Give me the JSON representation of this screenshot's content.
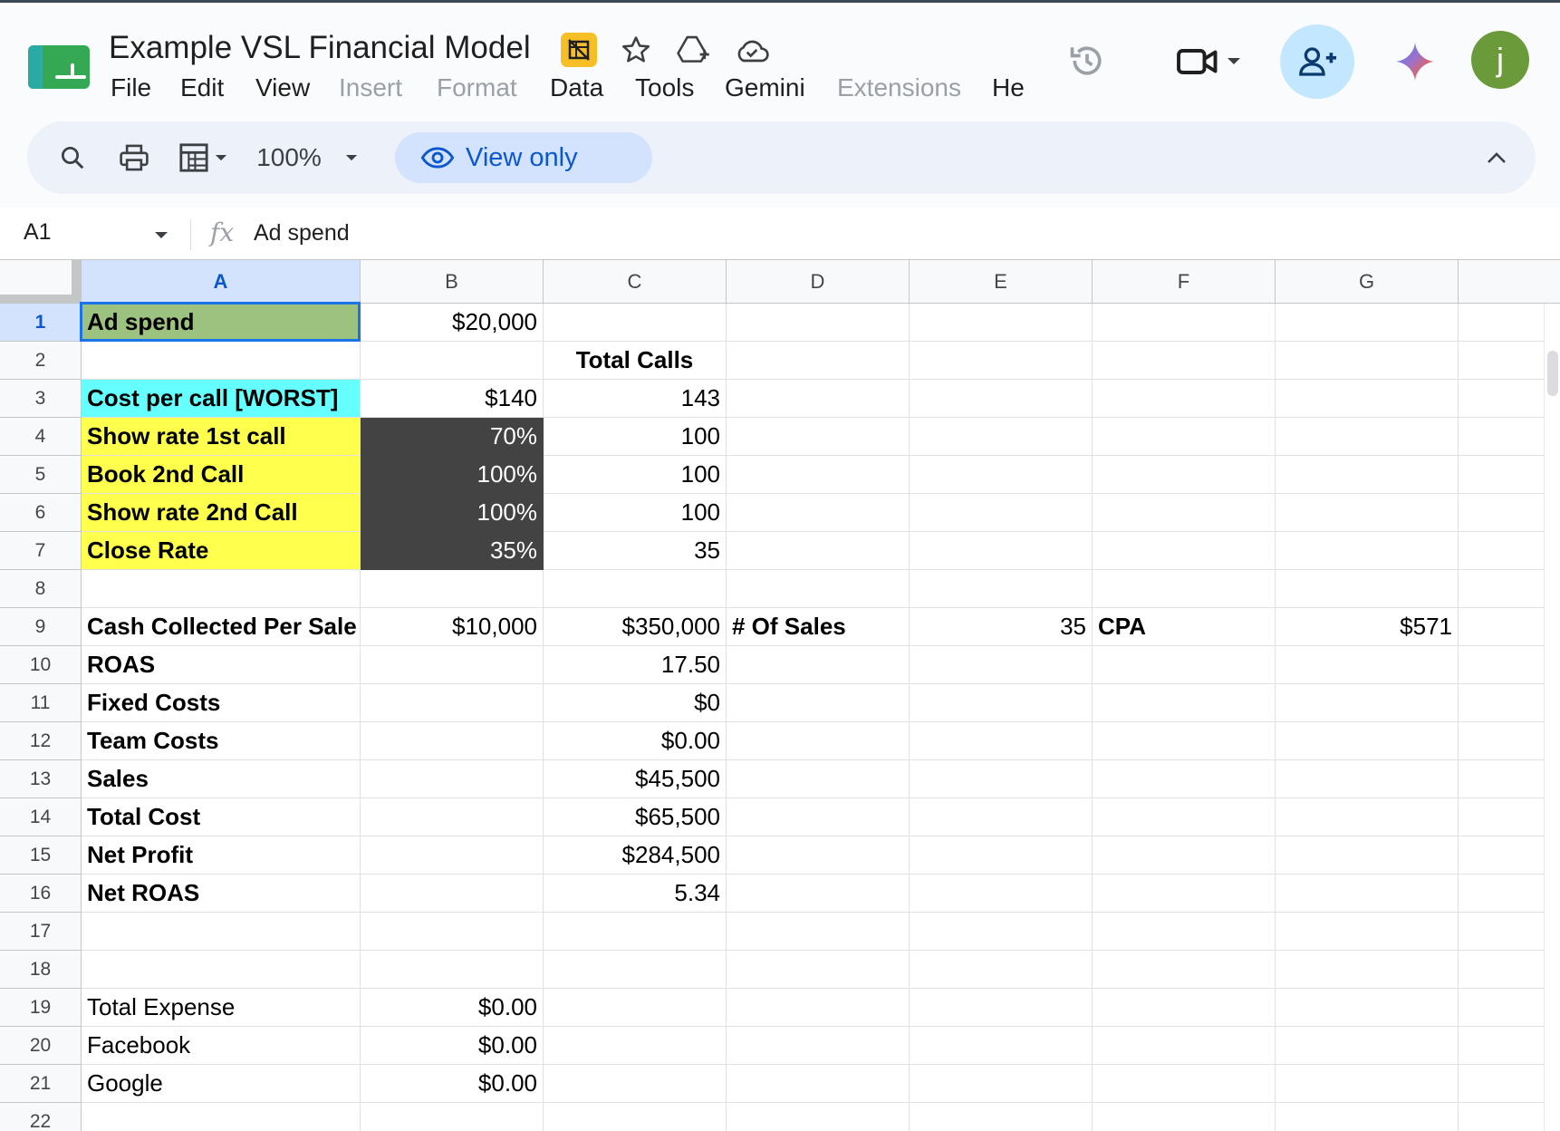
{
  "app": {
    "title": "Example VSL Financial Model",
    "avatar_initial": "j",
    "menu": [
      "File",
      "Edit",
      "View",
      "Insert",
      "Format",
      "Data",
      "Tools",
      "Gemini",
      "Extensions",
      "He"
    ]
  },
  "toolbar": {
    "zoom": "100%",
    "view_only_label": "View only"
  },
  "formula_bar": {
    "cell_ref": "A1",
    "content": "Ad spend"
  },
  "grid": {
    "columns": [
      "A",
      "B",
      "C",
      "D",
      "E",
      "F",
      "G"
    ],
    "rows": [
      "1",
      "2",
      "3",
      "4",
      "5",
      "6",
      "7",
      "8",
      "9",
      "10",
      "11",
      "12",
      "13",
      "14",
      "15",
      "16",
      "17",
      "18",
      "19",
      "20",
      "21",
      "22"
    ],
    "cells": {
      "r1": {
        "A": "Ad spend",
        "B": "$20,000"
      },
      "r2": {
        "C": "Total Calls"
      },
      "r3": {
        "A": "Cost per call [WORST]",
        "B": "$140",
        "C": "143"
      },
      "r4": {
        "A": "Show rate 1st call",
        "B": "70%",
        "C": "100"
      },
      "r5": {
        "A": "Book 2nd Call",
        "B": "100%",
        "C": "100"
      },
      "r6": {
        "A": "Show rate 2nd Call",
        "B": "100%",
        "C": "100"
      },
      "r7": {
        "A": "Close Rate",
        "B": "35%",
        "C": "35"
      },
      "r9": {
        "A": "Cash Collected Per Sale",
        "B": "$10,000",
        "C": "$350,000",
        "D": "# Of Sales",
        "E": "35",
        "F": "CPA",
        "G": "$571"
      },
      "r10": {
        "A": "ROAS",
        "C": "17.50"
      },
      "r11": {
        "A": "Fixed Costs",
        "C": "$0"
      },
      "r12": {
        "A": "Team Costs",
        "C": "$0.00"
      },
      "r13": {
        "A": "Sales",
        "C": "$45,500"
      },
      "r14": {
        "A": "Total Cost",
        "C": "$65,500"
      },
      "r15": {
        "A": "Net Profit",
        "C": "$284,500"
      },
      "r16": {
        "A": "Net ROAS",
        "C": "5.34"
      },
      "r19": {
        "A": "Total Expense",
        "B": "$0.00"
      },
      "r20": {
        "A": "Facebook",
        "B": "$0.00"
      },
      "r21": {
        "A": "Google",
        "B": "$0.00"
      }
    }
  },
  "colors": {
    "selected_cell_fill": "#9cc27f",
    "cyan_fill": "#66ffff",
    "yellow_fill": "#ffff4d",
    "dark_fill": "#434343",
    "selection_border": "#1a73e8"
  }
}
